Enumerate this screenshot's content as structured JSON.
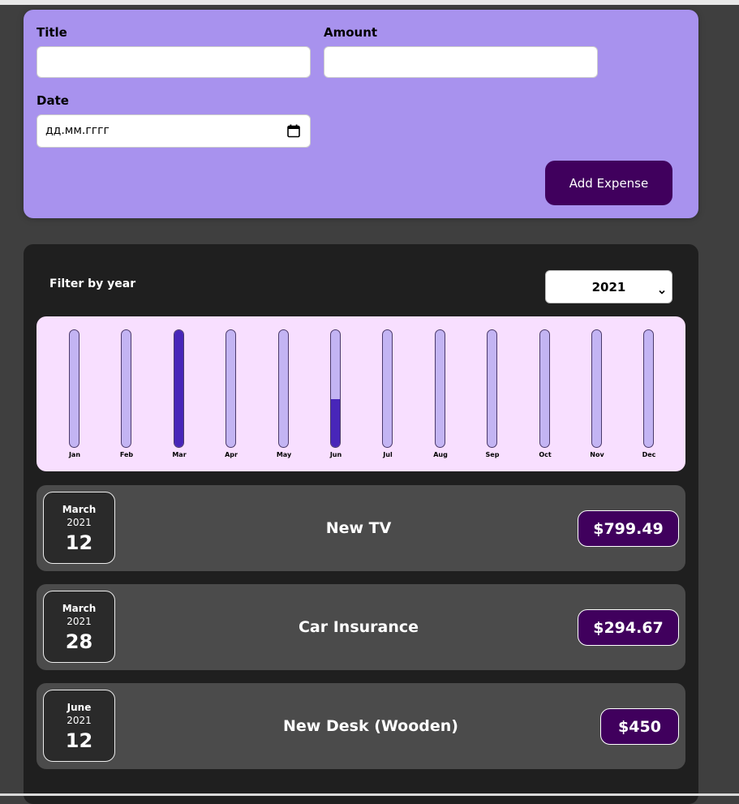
{
  "form": {
    "title_label": "Title",
    "amount_label": "Amount",
    "date_label": "Date",
    "title_value": "",
    "amount_value": "",
    "date_placeholder": "дд.мм.гггг",
    "submit_label": "Add Expense"
  },
  "filter": {
    "label": "Filter by year",
    "selected_year": "2021"
  },
  "chart_data": {
    "type": "bar",
    "categories": [
      "Jan",
      "Feb",
      "Mar",
      "Apr",
      "May",
      "Jun",
      "Jul",
      "Aug",
      "Sep",
      "Oct",
      "Nov",
      "Dec"
    ],
    "values": [
      0,
      0,
      1094.16,
      0,
      0,
      450,
      0,
      0,
      0,
      0,
      0,
      0
    ],
    "ylim": [
      0,
      1094.16
    ],
    "colors": {
      "track": "#c3b4f3",
      "fill": "#4826b9"
    }
  },
  "expenses": [
    {
      "month": "March",
      "year": "2021",
      "day": "12",
      "title": "New TV",
      "amount": "$799.49"
    },
    {
      "month": "March",
      "year": "2021",
      "day": "28",
      "title": "Car Insurance",
      "amount": "$294.67"
    },
    {
      "month": "June",
      "year": "2021",
      "day": "12",
      "title": "New Desk (Wooden)",
      "amount": "$450"
    }
  ],
  "colors": {
    "form_bg": "#a892ee",
    "accent": "#40005d",
    "panel_bg": "#1f1f1f",
    "item_bg": "#4b4b4b",
    "chart_bg": "#f8dfff"
  }
}
